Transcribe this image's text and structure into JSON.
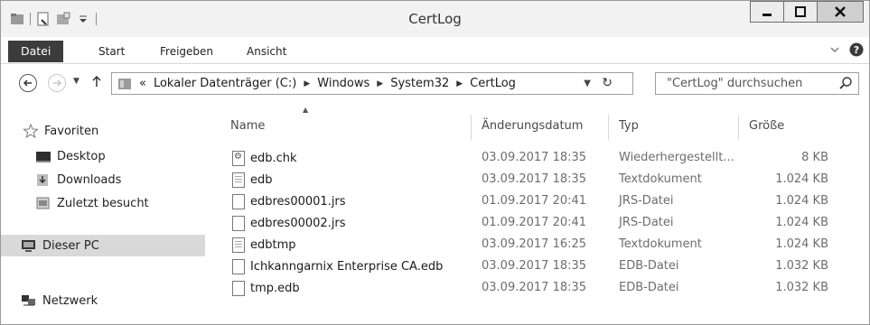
{
  "window": {
    "title": "CertLog"
  },
  "ribbon": {
    "tabs": [
      {
        "label": "Datei"
      },
      {
        "label": "Start"
      },
      {
        "label": "Freigeben"
      },
      {
        "label": "Ansicht"
      }
    ]
  },
  "address": {
    "overflow": "«",
    "crumbs": [
      "Lokaler Datenträger (C:)",
      "Windows",
      "System32",
      "CertLog"
    ]
  },
  "search": {
    "placeholder": "\"CertLog\" durchsuchen"
  },
  "nav": {
    "favorites": "Favoriten",
    "desktop": "Desktop",
    "downloads": "Downloads",
    "recent": "Zuletzt besucht",
    "thispc": "Dieser PC",
    "network": "Netzwerk"
  },
  "columns": {
    "name": "Name",
    "date": "Änderungsdatum",
    "type": "Typ",
    "size": "Größe"
  },
  "files": [
    {
      "name": "edb.chk",
      "date": "03.09.2017 18:35",
      "type": "Wiederhergestellt...",
      "size": "8 KB",
      "icon": "chk"
    },
    {
      "name": "edb",
      "date": "03.09.2017 18:35",
      "type": "Textdokument",
      "size": "1.024 KB",
      "icon": "txt"
    },
    {
      "name": "edbres00001.jrs",
      "date": "01.09.2017 20:41",
      "type": "JRS-Datei",
      "size": "1.024 KB",
      "icon": "file"
    },
    {
      "name": "edbres00002.jrs",
      "date": "01.09.2017 20:41",
      "type": "JRS-Datei",
      "size": "1.024 KB",
      "icon": "file"
    },
    {
      "name": "edbtmp",
      "date": "03.09.2017 16:25",
      "type": "Textdokument",
      "size": "1.024 KB",
      "icon": "txt"
    },
    {
      "name": "Ichkanngarnix Enterprise CA.edb",
      "date": "03.09.2017 18:35",
      "type": "EDB-Datei",
      "size": "1.032 KB",
      "icon": "file"
    },
    {
      "name": "tmp.edb",
      "date": "03.09.2017 18:35",
      "type": "EDB-Datei",
      "size": "1.032 KB",
      "icon": "file"
    }
  ]
}
